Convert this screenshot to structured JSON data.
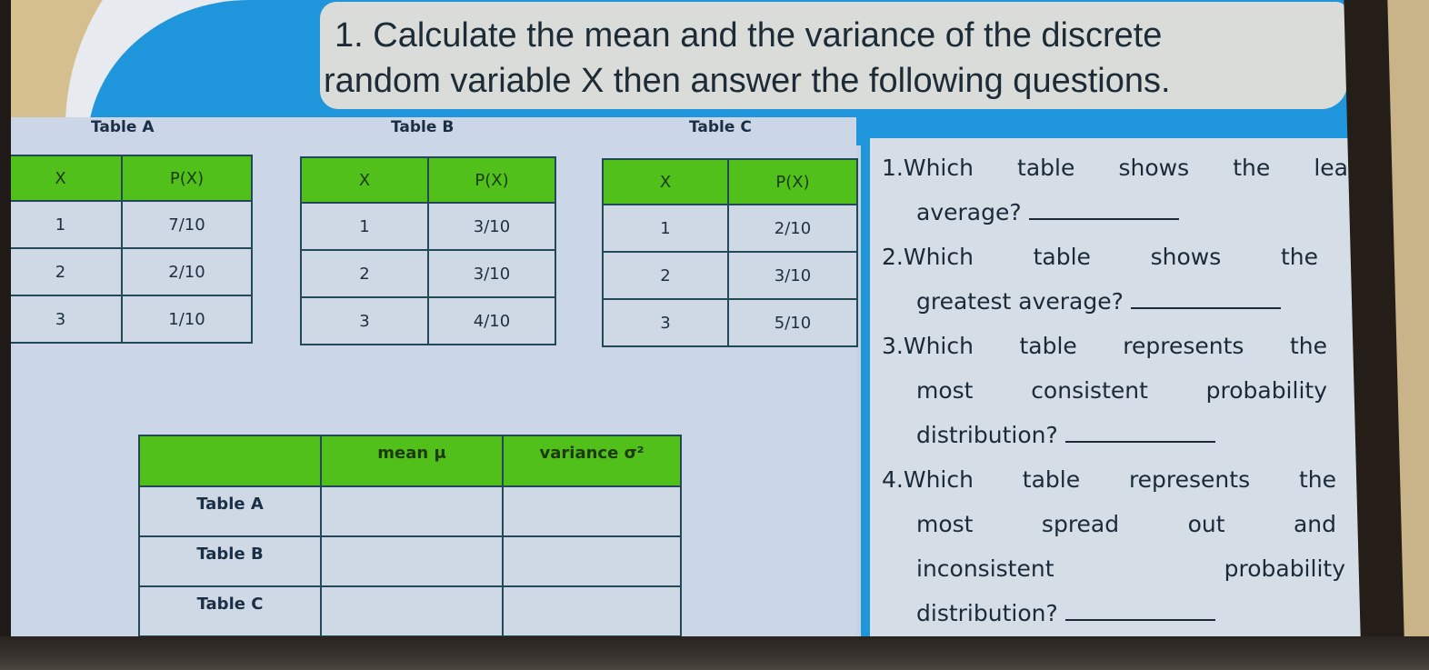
{
  "title": {
    "line1": "1. Calculate the mean and the variance of the discrete",
    "line2": "random variable X then answer the following questions."
  },
  "tables": [
    {
      "label": "Table A",
      "headers": [
        "X",
        "P(X)"
      ],
      "rows": [
        [
          "1",
          "7/10"
        ],
        [
          "2",
          "2/10"
        ],
        [
          "3",
          "1/10"
        ]
      ]
    },
    {
      "label": "Table B",
      "headers": [
        "X",
        "P(X)"
      ],
      "rows": [
        [
          "1",
          "3/10"
        ],
        [
          "2",
          "3/10"
        ],
        [
          "3",
          "4/10"
        ]
      ]
    },
    {
      "label": "Table C",
      "headers": [
        "X",
        "P(X)"
      ],
      "rows": [
        [
          "1",
          "2/10"
        ],
        [
          "2",
          "3/10"
        ],
        [
          "3",
          "5/10"
        ]
      ]
    }
  ],
  "summary_table": {
    "headers": [
      "",
      "mean μ",
      "variance σ²"
    ],
    "rows": [
      {
        "label": "Table A",
        "mean": "",
        "variance": ""
      },
      {
        "label": "Table B",
        "mean": "",
        "variance": ""
      },
      {
        "label": "Table C",
        "mean": "",
        "variance": ""
      }
    ]
  },
  "questions": {
    "q1": {
      "line1": [
        "1.Which",
        "table",
        "shows",
        "the",
        "leas"
      ],
      "line2": "average?"
    },
    "q2": {
      "line1": [
        "2.Which",
        "table",
        "shows",
        "the"
      ],
      "line2": "greatest average?"
    },
    "q3": {
      "line1": [
        "3.Which",
        "table",
        "represents",
        "the"
      ],
      "line2": [
        "most",
        "consistent",
        "probability"
      ],
      "line3": "distribution?"
    },
    "q4": {
      "line1": [
        "4.Which",
        "table",
        "represents",
        "the"
      ],
      "line2": [
        "most",
        "spread",
        "out",
        "and"
      ],
      "line3": [
        "inconsistent",
        "probability"
      ],
      "line4": "distribution?"
    }
  },
  "colors": {
    "header_green": "#52c01a",
    "slide_blue": "#1f95db",
    "text_dark": "#1a2a38"
  }
}
